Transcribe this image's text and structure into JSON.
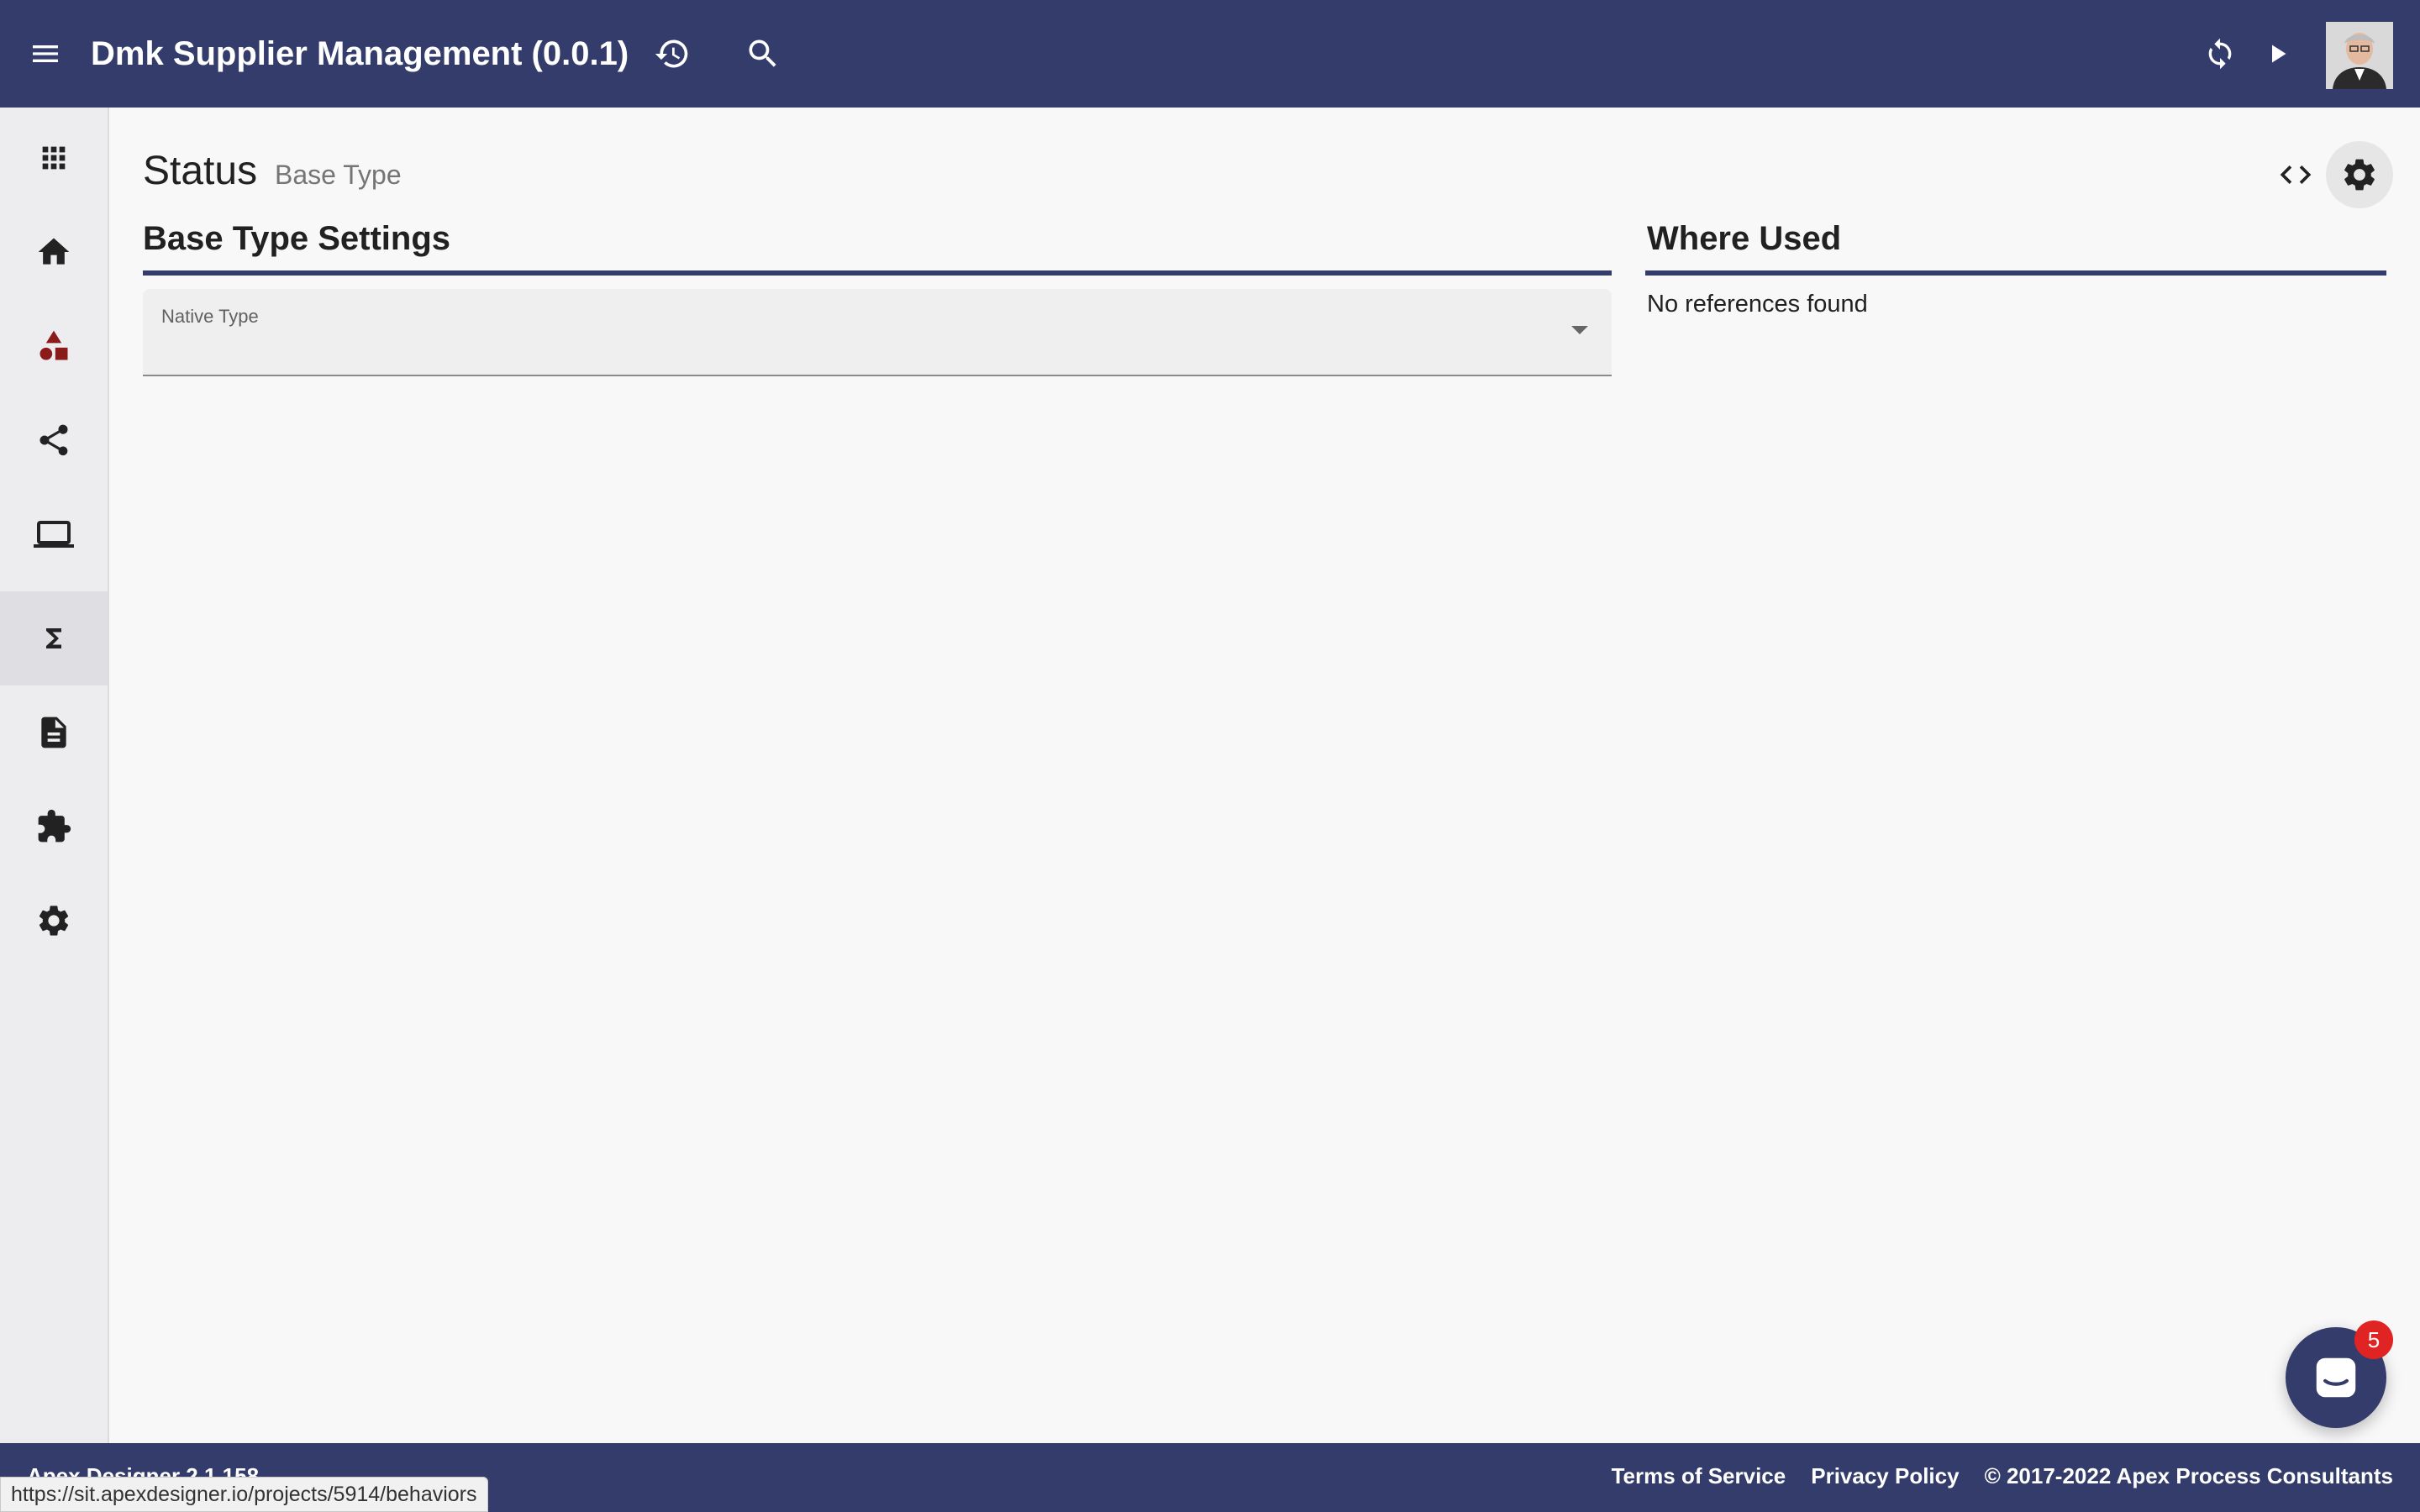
{
  "header": {
    "title": "Dmk Supplier Management (0.0.1)",
    "icons": [
      "menu-icon",
      "history-icon",
      "search-icon",
      "sync-icon",
      "play-icon"
    ],
    "user_avatar": "user avatar"
  },
  "sidebar": {
    "items": [
      {
        "icon": "apps-icon",
        "active": false
      },
      {
        "icon": "home-icon",
        "active": false
      },
      {
        "icon": "shapes-icon",
        "active": false,
        "color": "#8b1a1a"
      },
      {
        "icon": "share-icon",
        "active": false
      },
      {
        "icon": "laptop-icon",
        "active": false
      },
      {
        "icon": "sigma-icon",
        "active": true
      },
      {
        "icon": "document-icon",
        "active": false
      },
      {
        "icon": "puzzle-icon",
        "active": false
      },
      {
        "icon": "settings-icon",
        "active": false
      }
    ]
  },
  "page": {
    "title": "Status",
    "subtitle": "Base Type"
  },
  "settings_section": {
    "title": "Base Type Settings",
    "native_type": {
      "label": "Native Type",
      "value": ""
    }
  },
  "where_used": {
    "title": "Where Used",
    "empty_text": "No references found"
  },
  "footer": {
    "version": "Apex Designer 2.1.158",
    "links": [
      "Terms of Service",
      "Privacy Policy",
      "© 2017-2022 Apex Process Consultants"
    ]
  },
  "status_bar": {
    "url": "https://sit.apexdesigner.io/projects/5914/behaviors"
  },
  "chat": {
    "badge_count": "5"
  },
  "colors": {
    "brand": "#343c6b",
    "badge": "#e02424",
    "accent_icon": "#8b1a1a"
  }
}
